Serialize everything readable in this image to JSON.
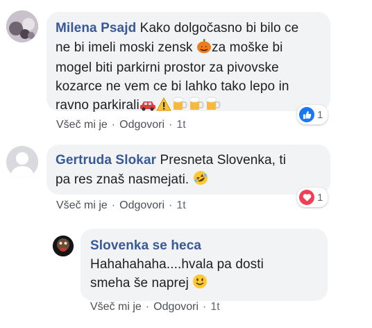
{
  "comments": [
    {
      "author": "Milena Psajd",
      "text_lines": [
        " Kako dolgočasno bi bilo ce",
        "ne bi imeli moski zensk ",
        "za moške bi",
        "mogel biti parkirni prostor za pivovske",
        "kozarce ne vem ce bi lahko tako lepo in",
        "ravno parkirali"
      ],
      "emojis": [
        "pumpkin-emoji",
        "car-emoji",
        "warning-emoji",
        "beer-mug-emoji",
        "beer-mug-emoji",
        "beer-mug-emoji"
      ],
      "actions": {
        "like": "Všeč mi je",
        "sep": "·",
        "reply": "Odgovori",
        "time": "1t"
      },
      "reaction": {
        "type": "like",
        "count": "1",
        "color": "#1877f2"
      }
    },
    {
      "author": "Gertruda Slokar",
      "text_lines": [
        " Presneta Slovenka, ti",
        "pa res znaš nasmejati. "
      ],
      "emojis": [
        "rofl-emoji"
      ],
      "actions": {
        "like": "Všeč mi je",
        "sep": "·",
        "reply": "Odgovori",
        "time": "1t"
      },
      "reaction": {
        "type": "love",
        "count": "1",
        "color": "#f33e58"
      }
    },
    {
      "author": "Slovenka se heca",
      "text_lines": [
        "Hahahahaha....hvala pa dosti",
        "smeha še naprej "
      ],
      "emojis": [
        "smile-emoji"
      ],
      "actions": {
        "like": "Všeč mi je",
        "sep": "·",
        "reply": "Odgovori",
        "time": "1t"
      }
    }
  ]
}
